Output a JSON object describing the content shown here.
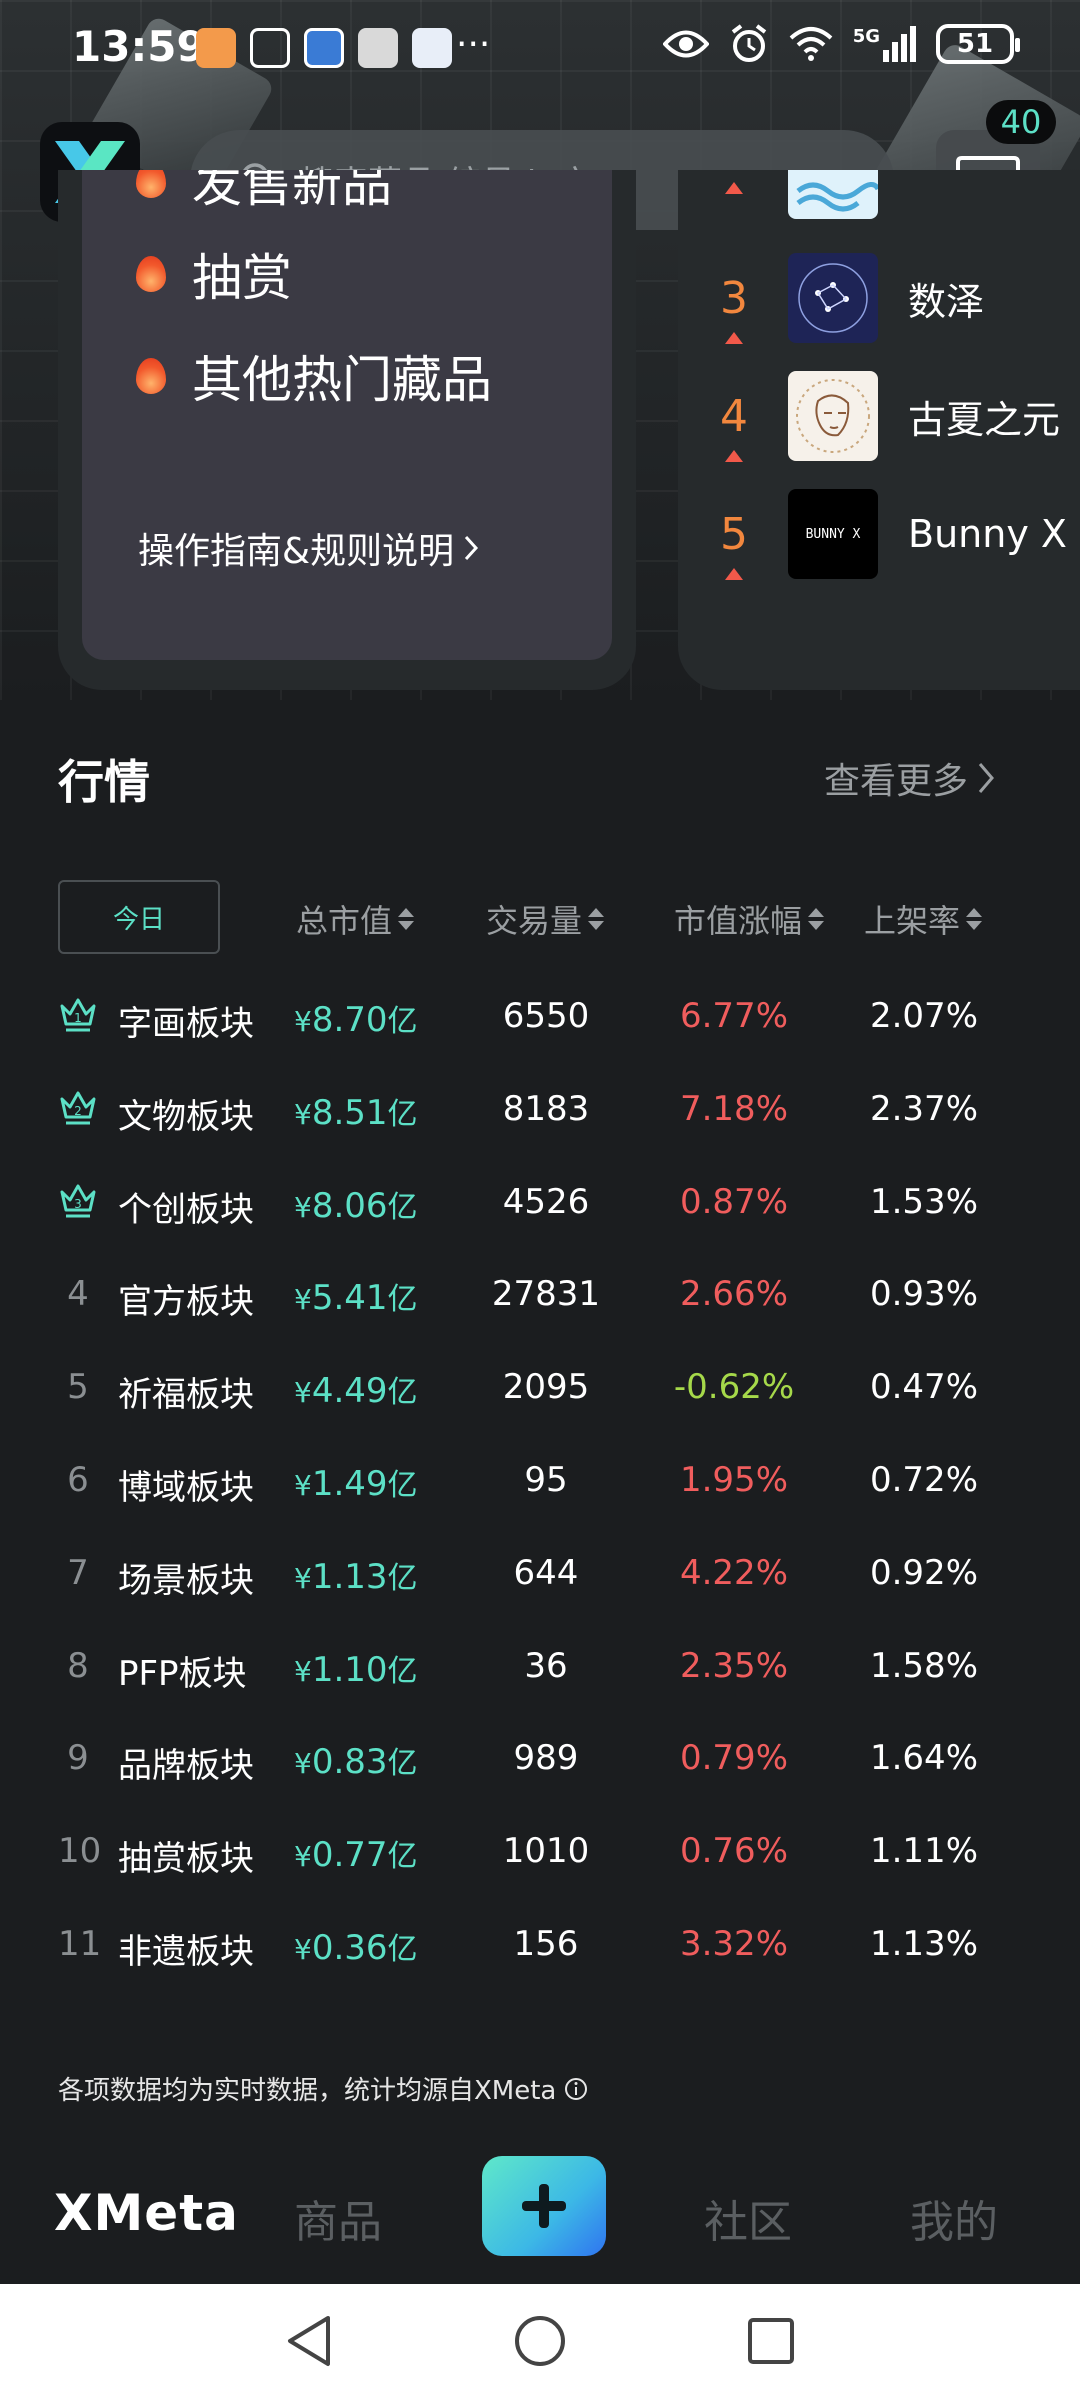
{
  "status_bar": {
    "time": "13:59",
    "more": "···",
    "network": "5G",
    "battery": "51"
  },
  "header": {
    "search_placeholder": "搜索藏品/编号/ip方",
    "chat_badge": "40"
  },
  "hot_list": {
    "items": [
      {
        "label": "发售新品"
      },
      {
        "label": "抽赏"
      },
      {
        "label": "其他热门藏品"
      }
    ],
    "guide_link": "操作指南&规则说明"
  },
  "ranking": {
    "items": [
      {
        "rank": "",
        "name": ""
      },
      {
        "rank": "3",
        "name": "数泽"
      },
      {
        "rank": "4",
        "name": "古夏之元"
      },
      {
        "rank": "5",
        "name": "Bunny X"
      }
    ],
    "thumb_text_bunny": "BUNNY X"
  },
  "market": {
    "title": "行情",
    "see_more": "查看更多",
    "today_label": "今日",
    "columns": {
      "cap": "总市值",
      "volume": "交易量",
      "change": "市值涨幅",
      "listing": "上架率"
    },
    "currency_symbol": "¥",
    "unit": "亿",
    "rows": [
      {
        "rank": "1",
        "name": "字画板块",
        "cap": "8.70",
        "volume": "6550",
        "change": "6.77%",
        "listing": "2.07%"
      },
      {
        "rank": "2",
        "name": "文物板块",
        "cap": "8.51",
        "volume": "8183",
        "change": "7.18%",
        "listing": "2.37%"
      },
      {
        "rank": "3",
        "name": "个创板块",
        "cap": "8.06",
        "volume": "4526",
        "change": "0.87%",
        "listing": "1.53%"
      },
      {
        "rank": "4",
        "name": "官方板块",
        "cap": "5.41",
        "volume": "27831",
        "change": "2.66%",
        "listing": "0.93%"
      },
      {
        "rank": "5",
        "name": "祈福板块",
        "cap": "4.49",
        "volume": "2095",
        "change": "-0.62%",
        "listing": "0.47%"
      },
      {
        "rank": "6",
        "name": "博域板块",
        "cap": "1.49",
        "volume": "95",
        "change": "1.95%",
        "listing": "0.72%"
      },
      {
        "rank": "7",
        "name": "场景板块",
        "cap": "1.13",
        "volume": "644",
        "change": "4.22%",
        "listing": "0.92%"
      },
      {
        "rank": "8",
        "name": "PFP板块",
        "cap": "1.10",
        "volume": "36",
        "change": "2.35%",
        "listing": "1.58%"
      },
      {
        "rank": "9",
        "name": "品牌板块",
        "cap": "0.83",
        "volume": "989",
        "change": "0.79%",
        "listing": "1.64%"
      },
      {
        "rank": "10",
        "name": "抽赏板块",
        "cap": "0.77",
        "volume": "1010",
        "change": "0.76%",
        "listing": "1.11%"
      },
      {
        "rank": "11",
        "name": "非遗板块",
        "cap": "0.36",
        "volume": "156",
        "change": "3.32%",
        "listing": "1.13%"
      }
    ],
    "footnote": "各项数据均为实时数据，统计均源自XMeta"
  },
  "bottom_nav": {
    "brand": "XMeta",
    "goods": "商品",
    "community": "社区",
    "mine": "我的"
  },
  "colors": {
    "accent": "#5ce0c6",
    "up": "#f05d5d",
    "down": "#a6d94a",
    "rank_orange": "#f2873e"
  },
  "icons": [
    "search-icon",
    "chat-icon",
    "flame-icon",
    "crown-icon",
    "sort-icon",
    "info-icon",
    "plus-icon",
    "back-icon",
    "home-icon",
    "recents-icon"
  ]
}
